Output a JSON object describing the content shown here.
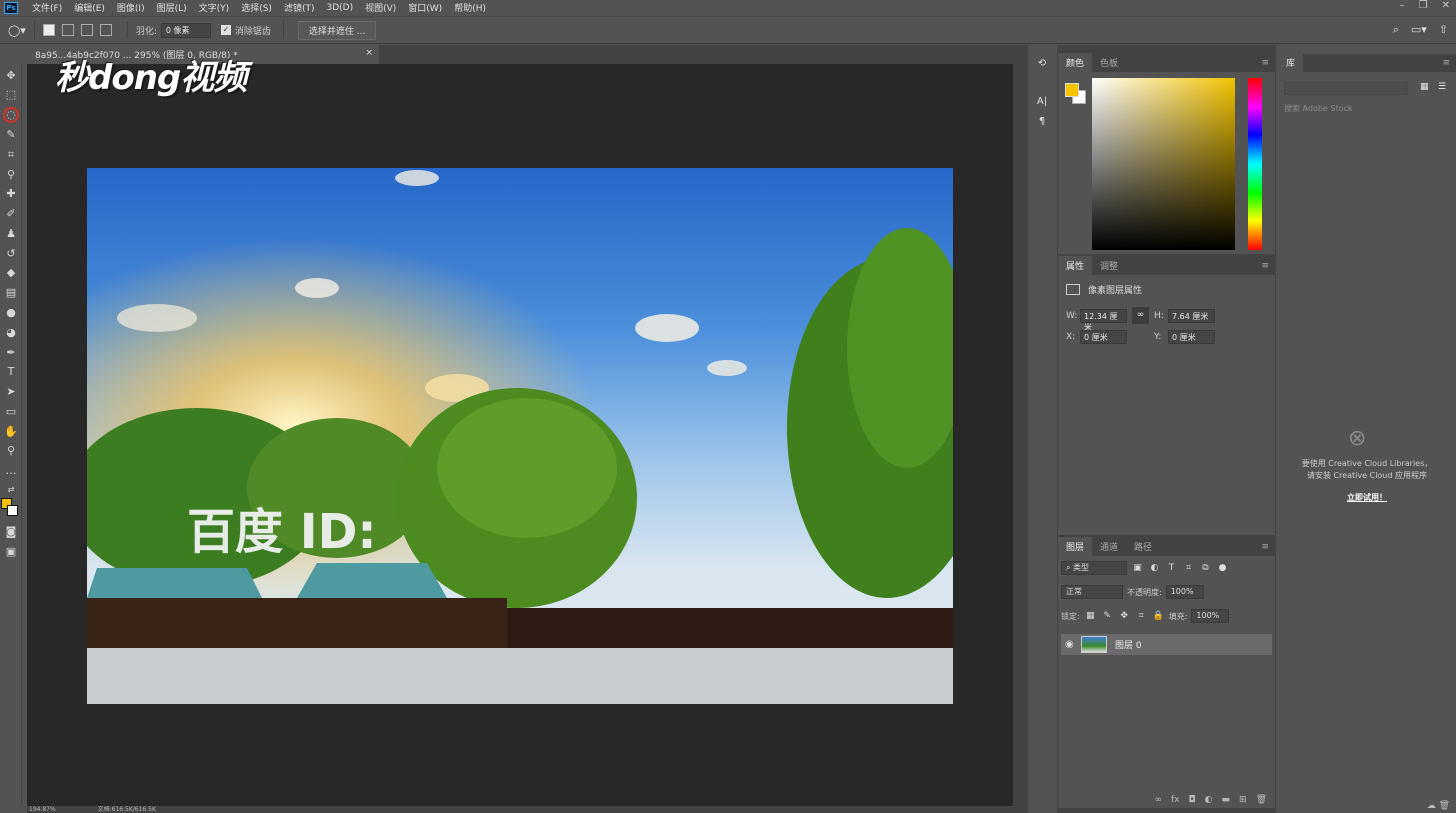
{
  "menubar": {
    "logo": "Ps",
    "items": [
      "文件(F)",
      "编辑(E)",
      "图像(I)",
      "图层(L)",
      "文字(Y)",
      "选择(S)",
      "滤镜(T)",
      "3D(D)",
      "视图(V)",
      "窗口(W)",
      "帮助(H)"
    ]
  },
  "options": {
    "feather_label": "羽化:",
    "feather_value": "0 像素",
    "antialias_label": "消除锯齿",
    "select_mask_label": "选择并遮住 ..."
  },
  "document": {
    "tab_title": "8a95...4ab9c2f070 ... 295% (图层 0, RGB/8) *",
    "close": "×"
  },
  "watermark": "秒dong视频",
  "canvas": {
    "overlay_text": "百度 ID:"
  },
  "status": {
    "zoom": "194.87%",
    "doc": "文档:616.5K/616.5K"
  },
  "color_panel": {
    "tabs": [
      "颜色",
      "色板"
    ],
    "foreground": "#f6c400",
    "background": "#ffffff"
  },
  "properties_panel": {
    "tabs": [
      "属性",
      "调整"
    ],
    "heading": "像素图层属性",
    "w_label": "W:",
    "w_value": "12.34 厘米",
    "h_label": "H:",
    "h_value": "7.64 厘米",
    "x_label": "X:",
    "x_value": "0 厘米",
    "y_label": "Y:",
    "y_value": "0 厘米"
  },
  "layers_panel": {
    "tabs": [
      "图层",
      "通道",
      "路径"
    ],
    "filter_kind": "类型",
    "blend_mode": "正常",
    "opacity_label": "不透明度:",
    "opacity_value": "100%",
    "lock_label": "锁定:",
    "fill_label": "填充:",
    "fill_value": "100%",
    "layers": [
      {
        "name": "图层 0"
      }
    ]
  },
  "library_panel": {
    "tab": "库",
    "search_placeholder": "搜索 Adobe Stock",
    "message_line1": "要使用 Creative Cloud Libraries，",
    "message_line2": "请安装 Creative Cloud 应用程序",
    "link": "立即试用！"
  }
}
